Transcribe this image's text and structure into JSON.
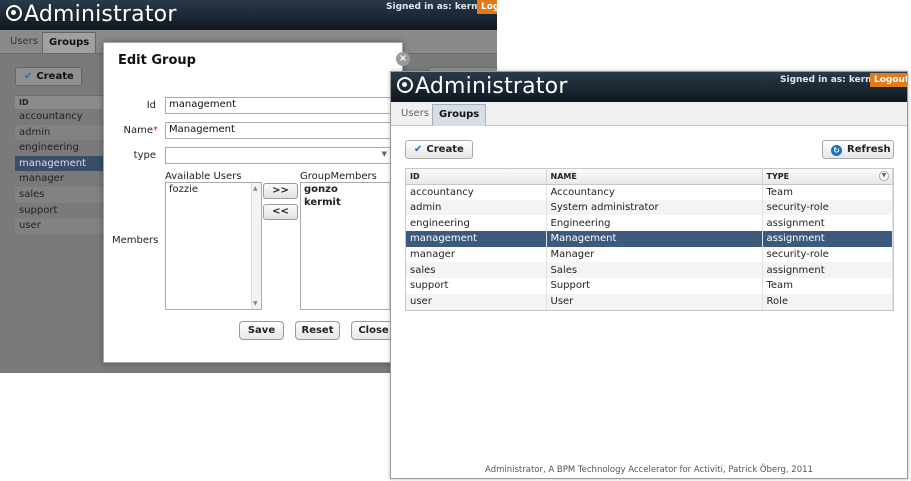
{
  "back": {
    "app_title": "Administrator",
    "signed_in": "Signed in as: kermit",
    "logout": "Logout",
    "tabs": [
      "Users",
      "Groups"
    ],
    "create": "Create",
    "list_header": "ID",
    "list": [
      "accountancy",
      "admin",
      "engineering",
      "management",
      "manager",
      "sales",
      "support",
      "user"
    ]
  },
  "dialog": {
    "title": "Edit Group",
    "close": "×",
    "id_label": "Id",
    "id_value": "management",
    "name_label": "Name",
    "required_mark": "*",
    "name_value": "Management",
    "type_label": "type",
    "type_value": "",
    "members_label": "Members",
    "available_label": "Available Users",
    "available": [
      "fozzie"
    ],
    "group_members_label": "GroupMembers",
    "group_members": [
      "gonzo",
      "kermit"
    ],
    "add_btn": ">>",
    "remove_btn": "<<",
    "save": "Save",
    "reset": "Reset",
    "close_btn": "Close"
  },
  "front": {
    "app_title": "Administrator",
    "signed_in": "Signed in as: kermit",
    "logout": "Logout",
    "tabs": [
      "Users",
      "Groups"
    ],
    "create": "Create",
    "refresh": "Refresh",
    "columns": [
      "ID",
      "NAME",
      "TYPE"
    ],
    "rows": [
      {
        "id": "accountancy",
        "name": "Accountancy",
        "type": "Team"
      },
      {
        "id": "admin",
        "name": "System administrator",
        "type": "security-role"
      },
      {
        "id": "engineering",
        "name": "Engineering",
        "type": "assignment"
      },
      {
        "id": "management",
        "name": "Management",
        "type": "assignment"
      },
      {
        "id": "manager",
        "name": "Manager",
        "type": "security-role"
      },
      {
        "id": "sales",
        "name": "Sales",
        "type": "assignment"
      },
      {
        "id": "support",
        "name": "Support",
        "type": "Team"
      },
      {
        "id": "user",
        "name": "User",
        "type": "Role"
      }
    ],
    "selected_row": 3,
    "footer": "Administrator, A BPM Technology Accelerator for Activiti, Patrick Öberg, 2011"
  },
  "colors": {
    "accent": "#1e6ec8",
    "logout": "#e07a1a",
    "selected": "#3b5a7e"
  }
}
